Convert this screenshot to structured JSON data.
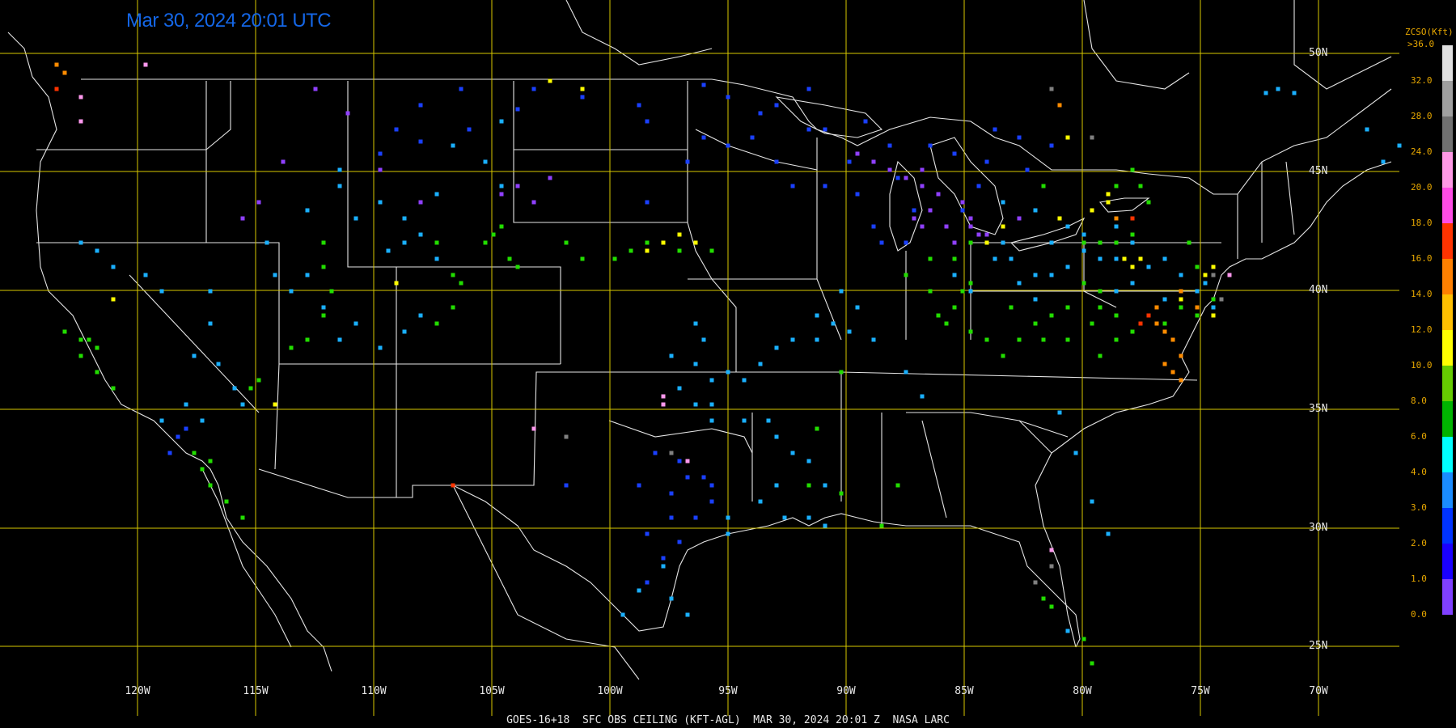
{
  "timestamp": "Mar 30, 2024 20:01 UTC",
  "footer": "GOES-16+18  SFC OBS CEILING (KFT-AGL)  MAR 30, 2024 20:01 Z  NASA LARC",
  "legend": {
    "title_line1": "ZCSO(Kft)",
    "max_label": ">36.0",
    "ticks": [
      "32.0",
      "28.0",
      "24.0",
      "20.0",
      "18.0",
      "16.0",
      "14.0",
      "12.0",
      "10.0",
      "8.0",
      "6.0",
      "4.0",
      "3.0",
      "2.0",
      "1.0",
      "0.0"
    ],
    "colors": [
      "#e0e0e0",
      "#a0a0a0",
      "#707070",
      "#ff99e6",
      "#ff4de6",
      "#ff3300",
      "#ff8000",
      "#ffbf00",
      "#ffff00",
      "#66cc00",
      "#00b300",
      "#00ffff",
      "#1a8cff",
      "#0033ff",
      "#1a00ff",
      "#8040ff"
    ]
  },
  "lat_labels": [
    "50N",
    "45N",
    "40N",
    "35N",
    "30N",
    "25N"
  ],
  "lon_labels": [
    "120W",
    "115W",
    "110W",
    "105W",
    "100W",
    "95W",
    "90W",
    "85W",
    "80W",
    "75W",
    "70W"
  ],
  "colors": {
    "grid": "#d8c800",
    "boundary": "#e6e6e6",
    "background": "#000000",
    "timestamp": "#1466e6",
    "legend_text": "#e8a800"
  },
  "stations": {
    "blue": [
      [
        660,
        110
      ],
      [
        720,
        120
      ],
      [
        790,
        130
      ],
      [
        870,
        105
      ],
      [
        940,
        140
      ],
      [
        1000,
        110
      ],
      [
        900,
        180
      ],
      [
        960,
        200
      ],
      [
        980,
        230
      ],
      [
        1020,
        230
      ],
      [
        1080,
        280
      ],
      [
        1070,
        150
      ],
      [
        1130,
        260
      ],
      [
        1020,
        160
      ],
      [
        850,
        200
      ],
      [
        800,
        150
      ],
      [
        640,
        135
      ],
      [
        580,
        160
      ],
      [
        520,
        175
      ],
      [
        470,
        190
      ],
      [
        520,
        130
      ],
      [
        570,
        110
      ],
      [
        490,
        160
      ],
      [
        1090,
        300
      ],
      [
        1120,
        300
      ],
      [
        1060,
        240
      ],
      [
        1110,
        220
      ],
      [
        1150,
        180
      ],
      [
        1180,
        190
      ],
      [
        1210,
        230
      ],
      [
        1190,
        260
      ],
      [
        1220,
        200
      ],
      [
        1230,
        160
      ],
      [
        1260,
        170
      ],
      [
        1270,
        210
      ],
      [
        1300,
        180
      ],
      [
        1100,
        180
      ],
      [
        1050,
        200
      ],
      [
        870,
        170
      ],
      [
        800,
        250
      ],
      [
        820,
        690
      ],
      [
        800,
        720
      ],
      [
        840,
        670
      ],
      [
        860,
        640
      ],
      [
        880,
        620
      ],
      [
        830,
        640
      ],
      [
        800,
        660
      ],
      [
        790,
        600
      ],
      [
        850,
        590
      ],
      [
        830,
        610
      ],
      [
        810,
        560
      ],
      [
        840,
        570
      ],
      [
        870,
        590
      ],
      [
        880,
        600
      ],
      [
        700,
        600
      ],
      [
        220,
        540
      ],
      [
        210,
        560
      ],
      [
        230,
        530
      ],
      [
        900,
        120
      ],
      [
        960,
        130
      ],
      [
        1000,
        160
      ],
      [
        930,
        170
      ]
    ],
    "lightblue": [
      [
        830,
        440
      ],
      [
        860,
        450
      ],
      [
        880,
        470
      ],
      [
        920,
        470
      ],
      [
        840,
        480
      ],
      [
        860,
        500
      ],
      [
        880,
        500
      ],
      [
        900,
        460
      ],
      [
        940,
        450
      ],
      [
        960,
        430
      ],
      [
        980,
        420
      ],
      [
        1010,
        420
      ],
      [
        1050,
        410
      ],
      [
        880,
        520
      ],
      [
        920,
        520
      ],
      [
        950,
        520
      ],
      [
        960,
        540
      ],
      [
        980,
        560
      ],
      [
        1000,
        570
      ],
      [
        1020,
        600
      ],
      [
        900,
        640
      ],
      [
        900,
        660
      ],
      [
        940,
        620
      ],
      [
        960,
        600
      ],
      [
        970,
        640
      ],
      [
        1000,
        640
      ],
      [
        1020,
        650
      ],
      [
        820,
        700
      ],
      [
        830,
        740
      ],
      [
        850,
        760
      ],
      [
        770,
        760
      ],
      [
        790,
        730
      ],
      [
        1140,
        490
      ],
      [
        1120,
        460
      ],
      [
        1180,
        340
      ],
      [
        1230,
        320
      ],
      [
        1250,
        320
      ],
      [
        1280,
        340
      ],
      [
        1300,
        340
      ],
      [
        1320,
        330
      ],
      [
        1340,
        310
      ],
      [
        1360,
        320
      ],
      [
        1260,
        350
      ],
      [
        1280,
        370
      ],
      [
        1200,
        360
      ],
      [
        1240,
        300
      ],
      [
        1300,
        300
      ],
      [
        1380,
        320
      ],
      [
        1380,
        360
      ],
      [
        1400,
        350
      ],
      [
        1420,
        330
      ],
      [
        1440,
        320
      ],
      [
        1460,
        340
      ],
      [
        1490,
        350
      ],
      [
        1500,
        380
      ],
      [
        1480,
        360
      ],
      [
        1440,
        370
      ],
      [
        1340,
        290
      ],
      [
        1320,
        280
      ],
      [
        1380,
        280
      ],
      [
        1400,
        300
      ],
      [
        1060,
        380
      ],
      [
        1030,
        400
      ],
      [
        1010,
        390
      ],
      [
        1040,
        360
      ],
      [
        1080,
        420
      ],
      [
        870,
        420
      ],
      [
        860,
        400
      ],
      [
        1280,
        260
      ],
      [
        1240,
        250
      ],
      [
        340,
        340
      ],
      [
        360,
        360
      ],
      [
        380,
        340
      ],
      [
        400,
        380
      ],
      [
        420,
        420
      ],
      [
        440,
        400
      ],
      [
        470,
        430
      ],
      [
        500,
        410
      ],
      [
        520,
        390
      ],
      [
        560,
        380
      ],
      [
        480,
        310
      ],
      [
        500,
        300
      ],
      [
        520,
        290
      ],
      [
        540,
        320
      ],
      [
        120,
        310
      ],
      [
        100,
        300
      ],
      [
        140,
        330
      ],
      [
        180,
        340
      ],
      [
        200,
        360
      ],
      [
        260,
        360
      ],
      [
        260,
        400
      ],
      [
        240,
        440
      ],
      [
        270,
        450
      ],
      [
        290,
        480
      ],
      [
        300,
        500
      ],
      [
        230,
        500
      ],
      [
        250,
        520
      ],
      [
        200,
        520
      ],
      [
        330,
        300
      ],
      [
        380,
        260
      ],
      [
        420,
        230
      ],
      [
        470,
        250
      ],
      [
        500,
        270
      ],
      [
        540,
        240
      ],
      [
        420,
        210
      ],
      [
        440,
        270
      ],
      [
        560,
        180
      ],
      [
        600,
        200
      ],
      [
        620,
        150
      ],
      [
        620,
        230
      ],
      [
        1580,
        110
      ],
      [
        1690,
        160
      ],
      [
        1710,
        200
      ],
      [
        1730,
        180
      ],
      [
        1565,
        115
      ],
      [
        1600,
        115
      ],
      [
        1310,
        510
      ],
      [
        1330,
        560
      ],
      [
        1350,
        620
      ],
      [
        1370,
        660
      ],
      [
        1320,
        780
      ]
    ],
    "green": [
      [
        1090,
        650
      ],
      [
        1110,
        600
      ],
      [
        1040,
        610
      ],
      [
        1000,
        600
      ],
      [
        1010,
        530
      ],
      [
        1040,
        460
      ],
      [
        1160,
        390
      ],
      [
        1180,
        380
      ],
      [
        1200,
        410
      ],
      [
        1220,
        420
      ],
      [
        1240,
        440
      ],
      [
        1260,
        420
      ],
      [
        1280,
        400
      ],
      [
        1300,
        390
      ],
      [
        1320,
        380
      ],
      [
        1360,
        380
      ],
      [
        1380,
        390
      ],
      [
        1400,
        410
      ],
      [
        1420,
        390
      ],
      [
        1440,
        400
      ],
      [
        1460,
        380
      ],
      [
        1480,
        390
      ],
      [
        1500,
        370
      ],
      [
        1360,
        360
      ],
      [
        1340,
        350
      ],
      [
        1250,
        380
      ],
      [
        1200,
        350
      ],
      [
        1170,
        400
      ],
      [
        1190,
        360
      ],
      [
        1290,
        420
      ],
      [
        1320,
        420
      ],
      [
        1350,
        400
      ],
      [
        1360,
        440
      ],
      [
        1380,
        420
      ],
      [
        1480,
        330
      ],
      [
        1470,
        300
      ],
      [
        1400,
        290
      ],
      [
        1380,
        300
      ],
      [
        1360,
        300
      ],
      [
        1340,
        300
      ],
      [
        1150,
        320
      ],
      [
        1180,
        320
      ],
      [
        1200,
        300
      ],
      [
        1220,
        290
      ],
      [
        1120,
        340
      ],
      [
        1150,
        360
      ],
      [
        700,
        300
      ],
      [
        720,
        320
      ],
      [
        760,
        320
      ],
      [
        780,
        310
      ],
      [
        800,
        300
      ],
      [
        840,
        310
      ],
      [
        880,
        310
      ],
      [
        540,
        300
      ],
      [
        560,
        340
      ],
      [
        570,
        350
      ],
      [
        560,
        380
      ],
      [
        540,
        400
      ],
      [
        400,
        300
      ],
      [
        400,
        330
      ],
      [
        410,
        360
      ],
      [
        400,
        390
      ],
      [
        380,
        420
      ],
      [
        360,
        430
      ],
      [
        120,
        430
      ],
      [
        110,
        420
      ],
      [
        100,
        440
      ],
      [
        120,
        460
      ],
      [
        140,
        480
      ],
      [
        100,
        420
      ],
      [
        80,
        410
      ],
      [
        1290,
        740
      ],
      [
        1300,
        750
      ],
      [
        1340,
        790
      ],
      [
        1350,
        820
      ],
      [
        640,
        330
      ],
      [
        630,
        320
      ],
      [
        1400,
        210
      ],
      [
        1410,
        230
      ],
      [
        1420,
        250
      ],
      [
        1380,
        230
      ],
      [
        1290,
        230
      ],
      [
        620,
        280
      ],
      [
        610,
        290
      ],
      [
        600,
        300
      ],
      [
        310,
        480
      ],
      [
        320,
        470
      ],
      [
        240,
        560
      ],
      [
        260,
        570
      ],
      [
        250,
        580
      ],
      [
        260,
        600
      ],
      [
        280,
        620
      ],
      [
        300,
        640
      ]
    ],
    "purple": [
      [
        1060,
        190
      ],
      [
        1080,
        200
      ],
      [
        1100,
        210
      ],
      [
        1120,
        220
      ],
      [
        1140,
        230
      ],
      [
        1160,
        240
      ],
      [
        1190,
        250
      ],
      [
        1200,
        280
      ],
      [
        1220,
        290
      ],
      [
        1240,
        280
      ],
      [
        1260,
        270
      ],
      [
        1200,
        270
      ],
      [
        1210,
        290
      ],
      [
        1180,
        300
      ],
      [
        1170,
        280
      ],
      [
        1150,
        260
      ],
      [
        1140,
        280
      ],
      [
        1130,
        270
      ],
      [
        1140,
        210
      ],
      [
        620,
        240
      ],
      [
        640,
        230
      ],
      [
        520,
        250
      ],
      [
        470,
        210
      ],
      [
        430,
        140
      ],
      [
        390,
        110
      ],
      [
        350,
        200
      ],
      [
        320,
        250
      ],
      [
        300,
        270
      ],
      [
        660,
        250
      ],
      [
        680,
        220
      ]
    ],
    "yellow": [
      [
        1320,
        170
      ],
      [
        1370,
        250
      ],
      [
        1350,
        260
      ],
      [
        1310,
        270
      ],
      [
        1220,
        300
      ],
      [
        1240,
        280
      ],
      [
        1390,
        320
      ],
      [
        1400,
        330
      ],
      [
        1410,
        320
      ],
      [
        1460,
        370
      ],
      [
        1480,
        380
      ],
      [
        1500,
        390
      ],
      [
        1490,
        340
      ],
      [
        1500,
        330
      ],
      [
        840,
        290
      ],
      [
        860,
        300
      ],
      [
        820,
        300
      ],
      [
        800,
        310
      ],
      [
        340,
        500
      ],
      [
        490,
        350
      ],
      [
        720,
        110
      ],
      [
        680,
        100
      ],
      [
        140,
        370
      ],
      [
        1370,
        240
      ]
    ],
    "orange": [
      [
        1420,
        390
      ],
      [
        1430,
        400
      ],
      [
        1440,
        410
      ],
      [
        1450,
        420
      ],
      [
        1460,
        440
      ],
      [
        1440,
        450
      ],
      [
        1450,
        460
      ],
      [
        1460,
        470
      ],
      [
        1480,
        380
      ],
      [
        1460,
        360
      ],
      [
        1430,
        380
      ],
      [
        80,
        90
      ],
      [
        70,
        80
      ],
      [
        1310,
        130
      ],
      [
        1380,
        270
      ]
    ],
    "red": [
      [
        1400,
        270
      ],
      [
        1420,
        390
      ],
      [
        70,
        110
      ],
      [
        560,
        600
      ],
      [
        1410,
        400
      ]
    ],
    "pink": [
      [
        1520,
        340
      ],
      [
        180,
        80
      ],
      [
        100,
        120
      ],
      [
        100,
        150
      ],
      [
        1300,
        680
      ],
      [
        820,
        490
      ],
      [
        850,
        570
      ],
      [
        660,
        530
      ],
      [
        820,
        500
      ]
    ],
    "gray": [
      [
        1300,
        110
      ],
      [
        1350,
        170
      ],
      [
        1500,
        340
      ],
      [
        1510,
        370
      ],
      [
        700,
        540
      ],
      [
        830,
        560
      ],
      [
        1300,
        700
      ],
      [
        1280,
        720
      ]
    ]
  }
}
